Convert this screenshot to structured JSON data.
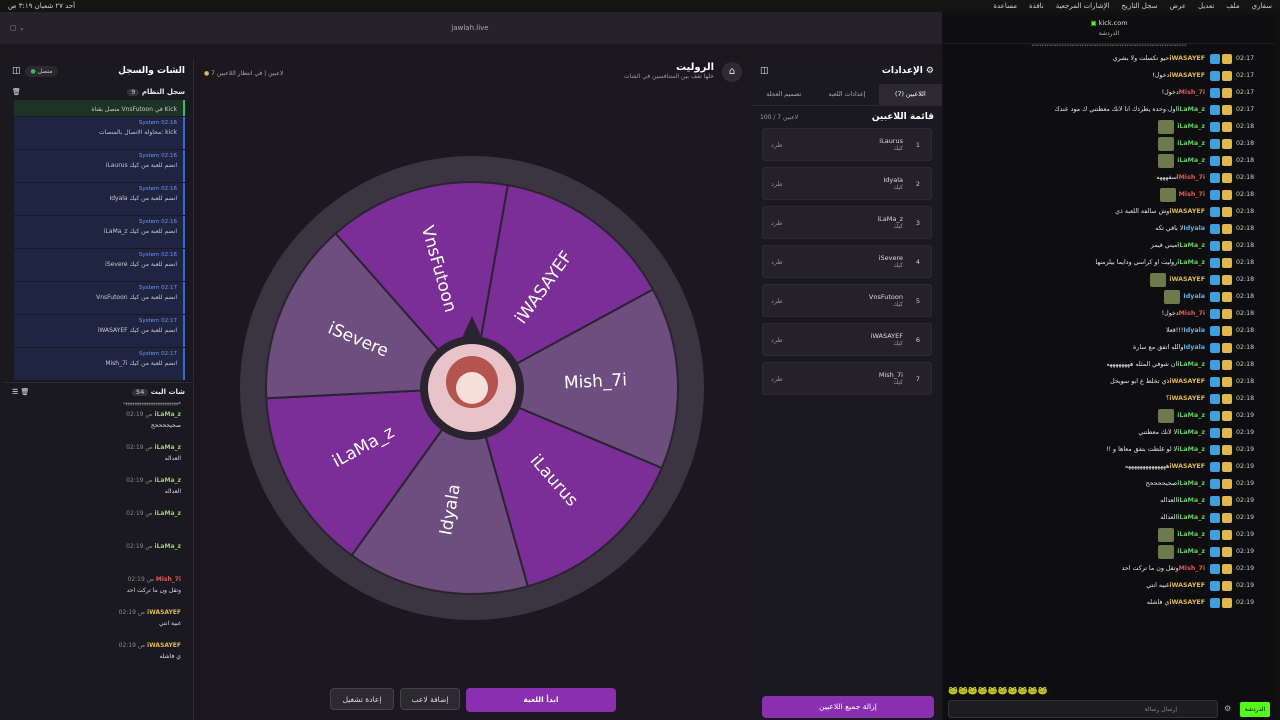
{
  "menubar": {
    "left": "أحد ٢٧ شعبان ٣:١٩ ص",
    "items": [
      "سفاري",
      "ملف",
      "تعديل",
      "عرض",
      "سجل التاريخ",
      "الإشارات المرجعية",
      "نافذة",
      "مساعدة"
    ]
  },
  "browser": {
    "url": "jawlah.live"
  },
  "left_panel": {
    "title": "الشات والسجل",
    "status": "متصل",
    "syslog_title": "سجل النظام",
    "syslog_count": "9",
    "logs": [
      {
        "who": "",
        "msg": "متصل بقناة VnsFutoon في Kick"
      },
      {
        "who": "System 02:16",
        "msg": "محاولة الاتصال بالمنصات: kick"
      },
      {
        "who": "System 02:16",
        "msg": "iLaurus انضم للعبة من كيك"
      },
      {
        "who": "System 02:16",
        "msg": "Idyala انضم للعبة من كيك"
      },
      {
        "who": "System 02:16",
        "msg": "iLaMa_z انضم للعبة من كيك"
      },
      {
        "who": "System 02:16",
        "msg": "iSevere انضم للعبة من كيك"
      },
      {
        "who": "System 02:17",
        "msg": "VnsFutoon انضم للعبة من كيك"
      },
      {
        "who": "System 02:17",
        "msg": "iWASAYEF انضم للعبة من كيك"
      },
      {
        "who": "System 02:17",
        "msg": "Mish_7i انضم للعبة من كيك"
      }
    ],
    "chat_title": "شات البث",
    "chat_count": "54",
    "chat": [
      {
        "u": "iLaMa_z",
        "t": "02:19 ص",
        "b": "صحيححححح",
        "c": ""
      },
      {
        "u": "iLaMa_z",
        "t": "02:19 ص",
        "b": "العداله",
        "c": ""
      },
      {
        "u": "iLaMa_z",
        "t": "02:19 ص",
        "b": "العداله",
        "c": ""
      },
      {
        "u": "iLaMa_z",
        "t": "02:19 ص",
        "b": "",
        "c": ""
      },
      {
        "u": "iLaMa_z",
        "t": "02:19 ص",
        "b": "",
        "c": ""
      },
      {
        "u": "Mish_7i",
        "t": "02:19 ص",
        "b": "وتقل ون ما تركت احد",
        "c": "red"
      },
      {
        "u": "iWASAYEF",
        "t": "02:19 ص",
        "b": "غبية انتي",
        "c": "yel"
      },
      {
        "u": "iWASAYEF",
        "t": "02:19 ص",
        "b": "ي فاشله",
        "c": "yel"
      }
    ]
  },
  "center": {
    "title": "الروليت",
    "subtitle": "خلها تقف بين المتنافسين في الشات",
    "waiting": "في انتظار اللاعبين",
    "count": "7 لاعبين",
    "wheel": [
      "iWASAYEF",
      "Mish_7i",
      "iLaurus",
      "Idyala",
      "iLaMa_z",
      "iSevere",
      "VnsFutoon"
    ],
    "start": "ابدأ اللعبة",
    "add": "إضافة لاعب",
    "reset": "إعادة تشغيل"
  },
  "right_panel": {
    "title": "الإعدادات",
    "tabs": [
      "اللاعبين (7)",
      "إعدادات اللعبة",
      "تصميم العجلة"
    ],
    "list_title": "قائمة اللاعبين",
    "list_count": "100 / 7 لاعبين",
    "players": [
      {
        "n": "iLaurus",
        "i": "1"
      },
      {
        "n": "Idyala",
        "i": "2"
      },
      {
        "n": "iLaMa_z",
        "i": "3"
      },
      {
        "n": "iSevere",
        "i": "4"
      },
      {
        "n": "VnsFutoon",
        "i": "5"
      },
      {
        "n": "iWASAYEF",
        "i": "6"
      },
      {
        "n": "Mish_7i",
        "i": "7"
      }
    ],
    "kick_label": "طرد",
    "sub": "كيك",
    "remove_all": "إزالة جميع اللاعبين"
  },
  "twitch": {
    "url": "kick.com",
    "header": "الدردشة",
    "send": "الدردشة",
    "placeholder": "إرسال رسالة",
    "rows": [
      {
        "n": "iWASAYEF",
        "c": "#e0b84a",
        "b": "حيو تكسلت ولا بشري",
        "t": "02:17"
      },
      {
        "n": "iWASAYEF",
        "c": "#e0b84a",
        "b": "دخول!",
        "t": "02:17"
      },
      {
        "n": "Mish_7i",
        "c": "#e05a5a",
        "b": "دخول!",
        "t": "02:17"
      },
      {
        "n": "iLaMa_z",
        "c": "#66cc66",
        "b": "اول وحده يطردك انا لانك معطتني ك مود عندك",
        "t": "02:17"
      },
      {
        "n": "iLaMa_z",
        "c": "#66cc66",
        "b": "",
        "t": "02:18"
      },
      {
        "n": "iLaMa_z",
        "c": "#66cc66",
        "b": "",
        "t": "02:18"
      },
      {
        "n": "iLaMa_z",
        "c": "#66cc66",
        "b": "",
        "t": "02:18"
      },
      {
        "n": "Mish_7i",
        "c": "#e05a5a",
        "b": "اسفهههه",
        "t": "02:18"
      },
      {
        "n": "Mish_7i",
        "c": "#e05a5a",
        "b": "",
        "t": "02:18"
      },
      {
        "n": "iWASAYEF",
        "c": "#e0b84a",
        "b": "وش سالفة اللعبة ذي",
        "t": "02:18"
      },
      {
        "n": "Idyala",
        "c": "#5fb3e6",
        "b": "لا باقي تكه",
        "t": "02:18"
      },
      {
        "n": "iLaMa_z",
        "c": "#66cc66",
        "b": "ميني فيمز",
        "t": "02:18"
      },
      {
        "n": "iLaMa_z",
        "c": "#66cc66",
        "b": "روليت او كراسي ودايما بيلزمنها",
        "t": "02:18"
      },
      {
        "n": "iWASAYEF",
        "c": "#e0b84a",
        "b": "",
        "t": "02:18"
      },
      {
        "n": "Idyala",
        "c": "#5fb3e6",
        "b": "",
        "t": "02:18"
      },
      {
        "n": "Mish_7i",
        "c": "#e05a5a",
        "b": "دخول!",
        "t": "02:18"
      },
      {
        "n": "Idyala",
        "c": "#5fb3e6",
        "b": "!!!قعلا",
        "t": "02:18"
      },
      {
        "n": "Idyala",
        "c": "#5fb3e6",
        "b": "والله اتفق مع سارة",
        "t": "02:18"
      },
      {
        "n": "iLaMa_z",
        "c": "#66cc66",
        "b": "ان شوفي المثله ههههههههه",
        "t": "02:18"
      },
      {
        "n": "iWASAYEF",
        "c": "#e0b84a",
        "b": "ذي تخلط ع ابو سويحل",
        "t": "02:18"
      },
      {
        "n": "iWASAYEF",
        "c": "#e0b84a",
        "b": "؟",
        "t": "02:18"
      },
      {
        "n": "iLaMa_z",
        "c": "#66cc66",
        "b": "",
        "t": "02:19"
      },
      {
        "n": "iLaMa_z",
        "c": "#66cc66",
        "b": "لا لانك معطتني",
        "t": "02:19"
      },
      {
        "n": "iLaMa_z",
        "c": "#66cc66",
        "b": "لا لو غلطت بتفق معاها و !!",
        "t": "02:19"
      },
      {
        "n": "iWASAYEF",
        "c": "#e0b84a",
        "b": "ههههههههههههههه",
        "t": "02:19"
      },
      {
        "n": "iLaMa_z",
        "c": "#66cc66",
        "b": "صحيححححح",
        "t": "02:19"
      },
      {
        "n": "iLaMa_z",
        "c": "#66cc66",
        "b": "العداله",
        "t": "02:19"
      },
      {
        "n": "iLaMa_z",
        "c": "#66cc66",
        "b": "العداله",
        "t": "02:19"
      },
      {
        "n": "iLaMa_z",
        "c": "#66cc66",
        "b": "",
        "t": "02:19"
      },
      {
        "n": "iLaMa_z",
        "c": "#66cc66",
        "b": "",
        "t": "02:19"
      },
      {
        "n": "Mish_7i",
        "c": "#e05a5a",
        "b": "وتقل ون ما تركت احد",
        "t": "02:19"
      },
      {
        "n": "iWASAYEF",
        "c": "#e0b84a",
        "b": "غبيه انتي",
        "t": "02:19"
      },
      {
        "n": "iWASAYEF",
        "c": "#e0b84a",
        "b": "ي فاشله",
        "t": "02:19"
      }
    ]
  }
}
